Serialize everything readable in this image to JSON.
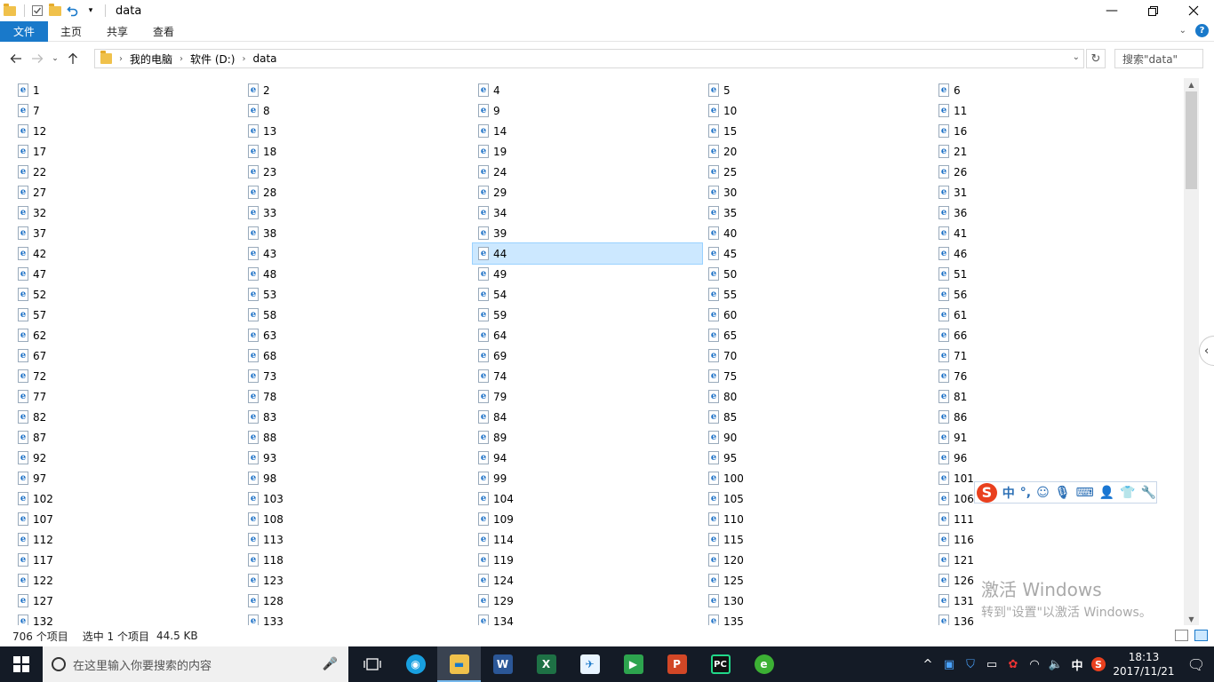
{
  "window": {
    "title": "data",
    "minimize_icon": "minimize-icon",
    "maximize_icon": "restore-icon",
    "close_icon": "close-icon"
  },
  "ribbon": {
    "tabs": [
      {
        "label": "文件"
      },
      {
        "label": "主页"
      },
      {
        "label": "共享"
      },
      {
        "label": "查看"
      }
    ]
  },
  "address": {
    "breadcrumbs": [
      "我的电脑",
      "软件 (D:)",
      "data"
    ],
    "search_placeholder": "搜索\"data\""
  },
  "files": {
    "selected": "44",
    "items": [
      "1",
      "2",
      "4",
      "5",
      "6",
      "7",
      "8",
      "9",
      "10",
      "11",
      "12",
      "13",
      "14",
      "15",
      "16",
      "17",
      "18",
      "19",
      "20",
      "21",
      "22",
      "23",
      "24",
      "25",
      "26",
      "27",
      "28",
      "29",
      "30",
      "31",
      "32",
      "33",
      "34",
      "35",
      "36",
      "37",
      "38",
      "39",
      "40",
      "41",
      "42",
      "43",
      "44",
      "45",
      "46",
      "47",
      "48",
      "49",
      "50",
      "51",
      "52",
      "53",
      "54",
      "55",
      "56",
      "57",
      "58",
      "59",
      "60",
      "61",
      "62",
      "63",
      "64",
      "65",
      "66",
      "67",
      "68",
      "69",
      "70",
      "71",
      "72",
      "73",
      "74",
      "75",
      "76",
      "77",
      "78",
      "79",
      "80",
      "81",
      "82",
      "83",
      "84",
      "85",
      "86",
      "87",
      "88",
      "89",
      "90",
      "91",
      "92",
      "93",
      "94",
      "95",
      "96",
      "97",
      "98",
      "99",
      "100",
      "101",
      "102",
      "103",
      "104",
      "105",
      "106",
      "107",
      "108",
      "109",
      "110",
      "111",
      "112",
      "113",
      "114",
      "115",
      "116",
      "117",
      "118",
      "119",
      "120",
      "121",
      "122",
      "123",
      "124",
      "125",
      "126",
      "127",
      "128",
      "129",
      "130",
      "131",
      "132",
      "133",
      "134",
      "135",
      "136"
    ]
  },
  "status": {
    "item_count": "706 个项目",
    "selected": "选中 1 个项目",
    "size": "44.5 KB"
  },
  "ime": {
    "mode": "中",
    "punct": "°,"
  },
  "watermark": {
    "line1": "激活 Windows",
    "line2": "转到\"设置\"以激活 Windows。"
  },
  "taskbar": {
    "search_placeholder": "在这里输入你要搜索的内容",
    "time": "18:13",
    "date": "2017/11/21",
    "ime_indicator": "中"
  }
}
